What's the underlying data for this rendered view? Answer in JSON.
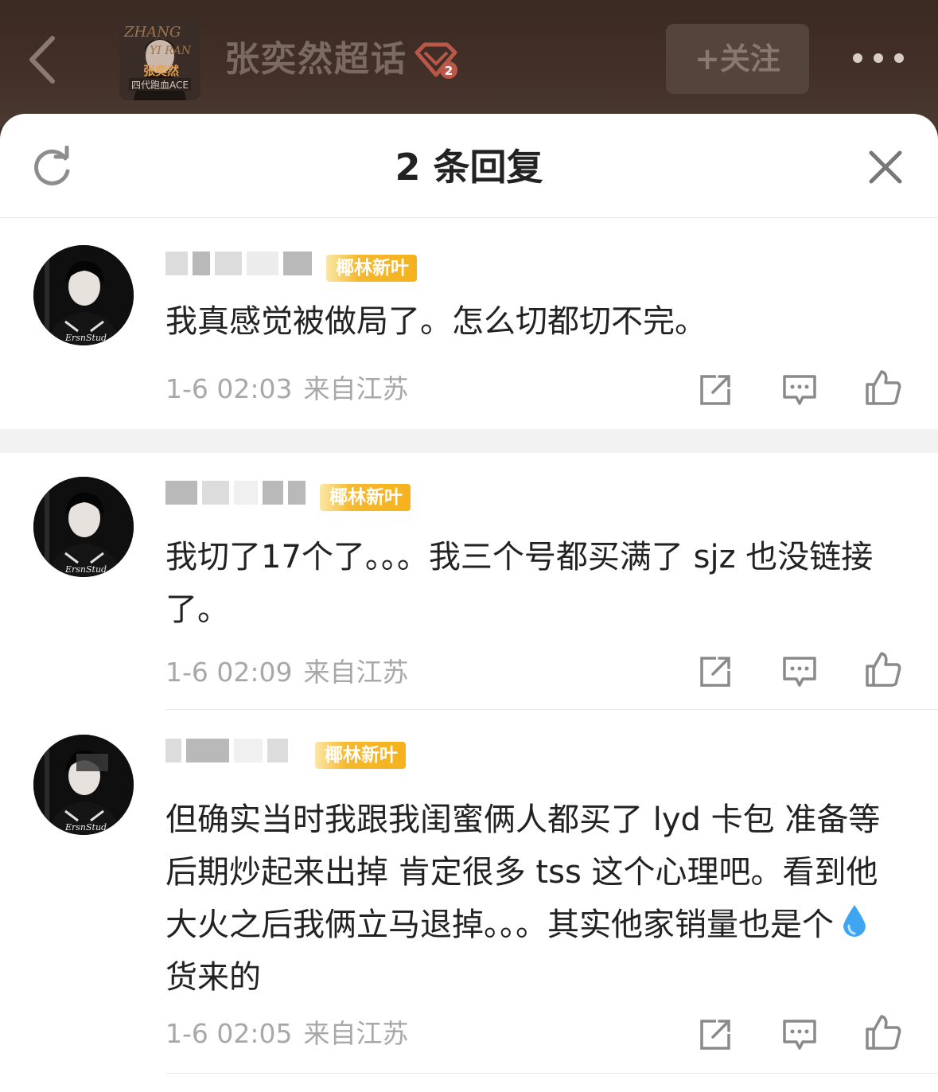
{
  "header": {
    "back_icon": "chevron-left-icon",
    "cover_text": [
      "ZHANG",
      "YI RAN",
      "张奕然",
      "四代跑血ACE"
    ],
    "topic_title": "张奕然超话",
    "topic_badge_level": "2",
    "follow_label": "+关注",
    "more_icon": "more-dots-icon"
  },
  "sheet": {
    "title": "2 条回复",
    "refresh_icon": "refresh-icon",
    "close_icon": "close-icon"
  },
  "comments": [
    {
      "badge": "椰林新叶",
      "text": "我真感觉被做局了。怎么切都切不完。",
      "time": "1-6 02:03",
      "location": "来自江苏"
    },
    {
      "badge": "椰林新叶",
      "text": "我切了17个了。。。我三个号都买满了 sjz 也没链接了。",
      "time": "1-6 02:09",
      "location": "来自江苏"
    },
    {
      "badge": "椰林新叶",
      "text_before": "但确实当时我跟我闺蜜俩人都买了 lyd 卡包 准备等后期炒起来出掉 肯定很多 tss 这个心理吧。看到他大火之后我俩立马退掉。。。其实他家销量也是个",
      "emoji": "water-drop-emoji",
      "text_after": "货来的",
      "time": "1-6 02:05",
      "location": "来自江苏"
    }
  ],
  "avatar_text": "ErsnStud",
  "actions": [
    "share-icon",
    "comment-icon",
    "like-icon"
  ],
  "colors": {
    "header_bg": "#3b2a22",
    "badge_gold": "#f5b21d",
    "text_main": "#222222",
    "text_meta": "#a8a8a8"
  }
}
